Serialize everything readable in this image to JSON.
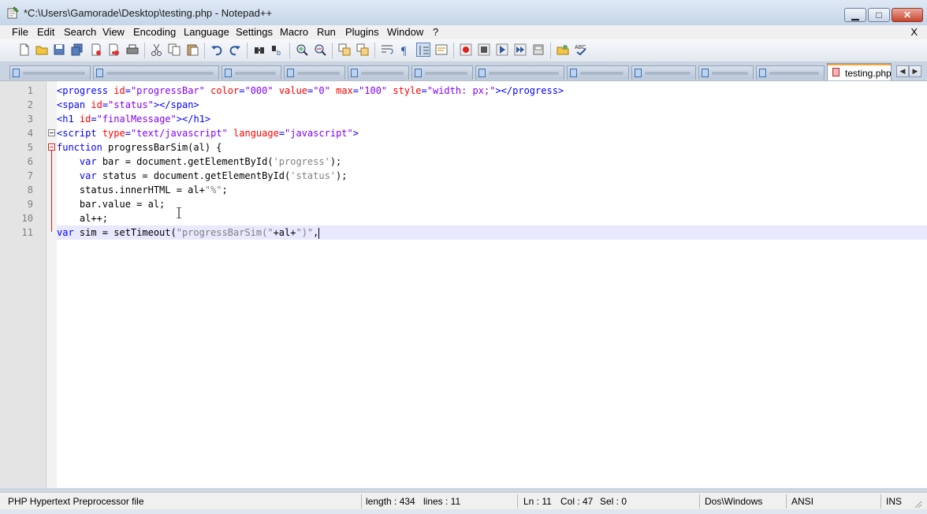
{
  "window": {
    "title": "*C:\\Users\\Gamorade\\Desktop\\testing.php - Notepad++",
    "minimize_glyph": "▁",
    "maximize_glyph": "□",
    "close_glyph": "✕"
  },
  "menu": {
    "items": [
      "File",
      "Edit",
      "Search",
      "View",
      "Encoding",
      "Language",
      "Settings",
      "Macro",
      "Run",
      "Plugins",
      "Window",
      "?"
    ],
    "close_label": "X"
  },
  "toolbar": {
    "icons": [
      "new-file-icon",
      "open-file-icon",
      "save-icon",
      "save-all-icon",
      "close-icon",
      "close-all-icon",
      "print-icon",
      "cut-icon",
      "copy-icon",
      "paste-icon",
      "undo-icon",
      "redo-icon",
      "find-icon",
      "replace-icon",
      "zoom-in-icon",
      "zoom-out-icon",
      "sync-vertical-icon",
      "sync-horizontal-icon",
      "word-wrap-icon",
      "show-all-chars-icon",
      "indent-guide-icon",
      "user-defined-language-icon",
      "record-macro-icon",
      "stop-record-icon",
      "playback-macro-icon",
      "run-macro-multiple-icon",
      "save-macro-icon",
      "launch-browser-icon",
      "spell-check-icon"
    ]
  },
  "tabs": {
    "active_label": "testing.php",
    "left_arrow": "◀",
    "right_arrow": "▶"
  },
  "editor": {
    "line_numbers": [
      "1",
      "2",
      "3",
      "4",
      "5",
      "6",
      "7",
      "8",
      "9",
      "10",
      "11"
    ],
    "current_line": 11
  },
  "status": {
    "file_type": "PHP Hypertext Preprocessor file",
    "length": "length : 434",
    "lines": "lines : 11",
    "ln": "Ln : 11",
    "col": "Col : 47",
    "sel": "Sel : 0",
    "eol": "Dos\\Windows",
    "encoding": "ANSI",
    "mode": "INS"
  },
  "colors": {
    "html_tag": "#0000ff",
    "html_attr": "#ff0000",
    "html_value": "#8000ff",
    "js_keyword": "#0000ff",
    "js_string": "#808080",
    "current_line_bg": "#e8e8ff",
    "active_tab_accent": "#f3a33b"
  }
}
